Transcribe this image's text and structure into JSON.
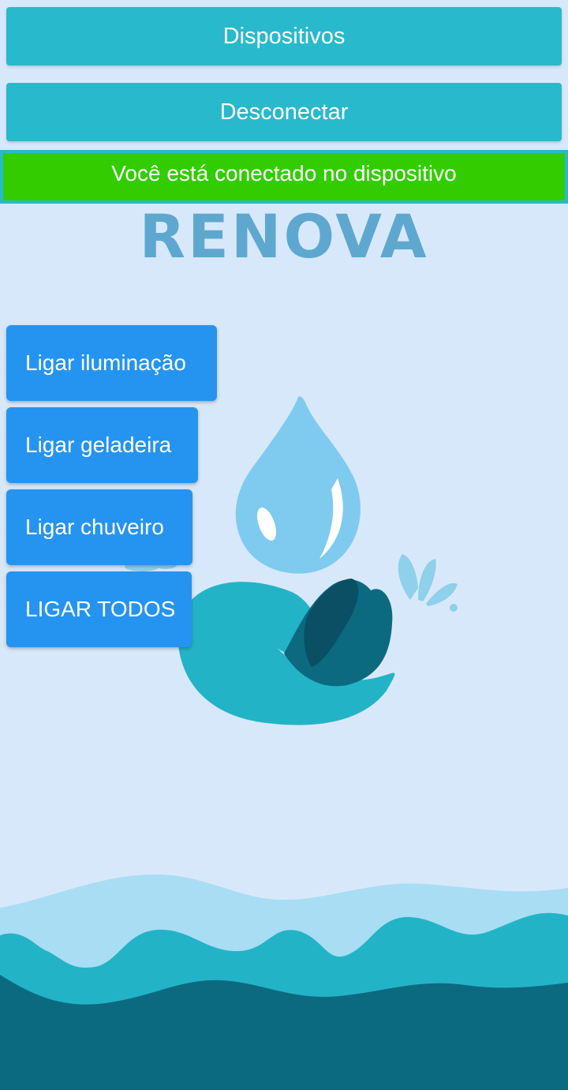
{
  "header": {
    "devices_button": "Dispositivos",
    "disconnect_button": "Desconectar",
    "status_message": "Você está conectado no dispositivo"
  },
  "logo": {
    "text": "RENOVA"
  },
  "actions": {
    "lighting": "Ligar iluminação",
    "fridge": "Ligar geladeira",
    "shower": "Ligar chuveiro",
    "all": "LIGAR TODOS"
  },
  "colors": {
    "background": "#d8e8fb",
    "top_button": "#29b9cc",
    "status_banner": "#33cc00",
    "action_button": "#2594f0",
    "logo_text": "#5ea8d0",
    "wave_light": "#a9ddf3",
    "wave_mid": "#22b4c6",
    "wave_dark": "#0c6a80"
  }
}
